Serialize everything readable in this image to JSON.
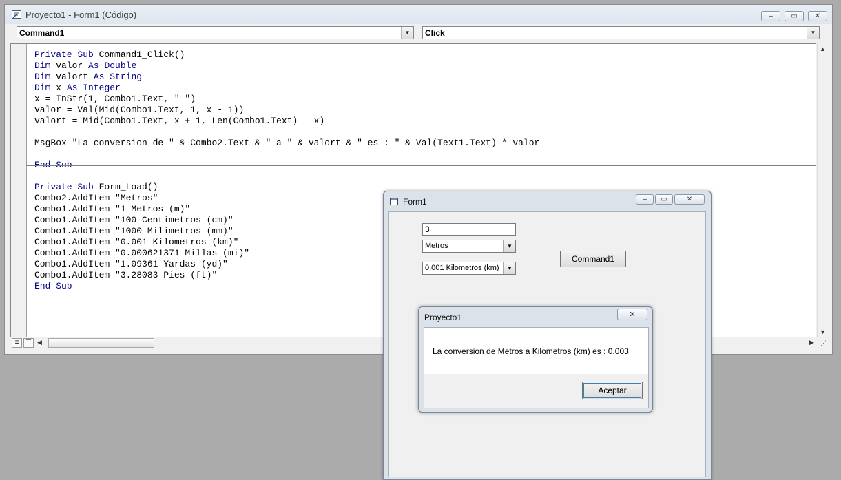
{
  "ide": {
    "title": "Proyecto1 - Form1 (Código)",
    "object_combo": "Command1",
    "proc_combo": "Click",
    "window_buttons": {
      "minimize": "–",
      "maximize": "▭",
      "close": "✕"
    },
    "code_lines": [
      "Private Sub Command1_Click()",
      "Dim valor As Double",
      "Dim valort As String",
      "Dim x As Integer",
      "x = InStr(1, Combo1.Text, \" \")",
      "valor = Val(Mid(Combo1.Text, 1, x - 1))",
      "valort = Mid(Combo1.Text, x + 1, Len(Combo1.Text) - x)",
      "",
      "MsgBox \"La conversion de \" & Combo2.Text & \" a \" & valort & \" es : \" & Val(Text1.Text) * valor",
      "",
      "End Sub",
      "",
      "Private Sub Form_Load()",
      "Combo2.AddItem \"Metros\"",
      "Combo1.AddItem \"1 Metros (m)\"",
      "Combo1.AddItem \"100 Centimetros (cm)\"",
      "Combo1.AddItem \"1000 Milimetros (mm)\"",
      "Combo1.AddItem \"0.001 Kilometros (km)\"",
      "Combo1.AddItem \"0.000621371 Millas (mi)\"",
      "Combo1.AddItem \"1.09361 Yardas (yd)\"",
      "Combo1.AddItem \"3.28083 Pies (ft)\"",
      "End Sub"
    ]
  },
  "form1": {
    "title": "Form1",
    "text1_value": "3",
    "combo2_value": "Metros",
    "combo1_value": "0.001 Kilometros (km)",
    "command_label": "Command1"
  },
  "msgbox": {
    "title": "Proyecto1",
    "message": "La conversion de Metros a Kilometros (km) es : 0.003",
    "ok_label": "Aceptar",
    "close_glyph": "✕"
  },
  "colors": {
    "keyword": "#00008b",
    "desktop": "#ababab"
  }
}
